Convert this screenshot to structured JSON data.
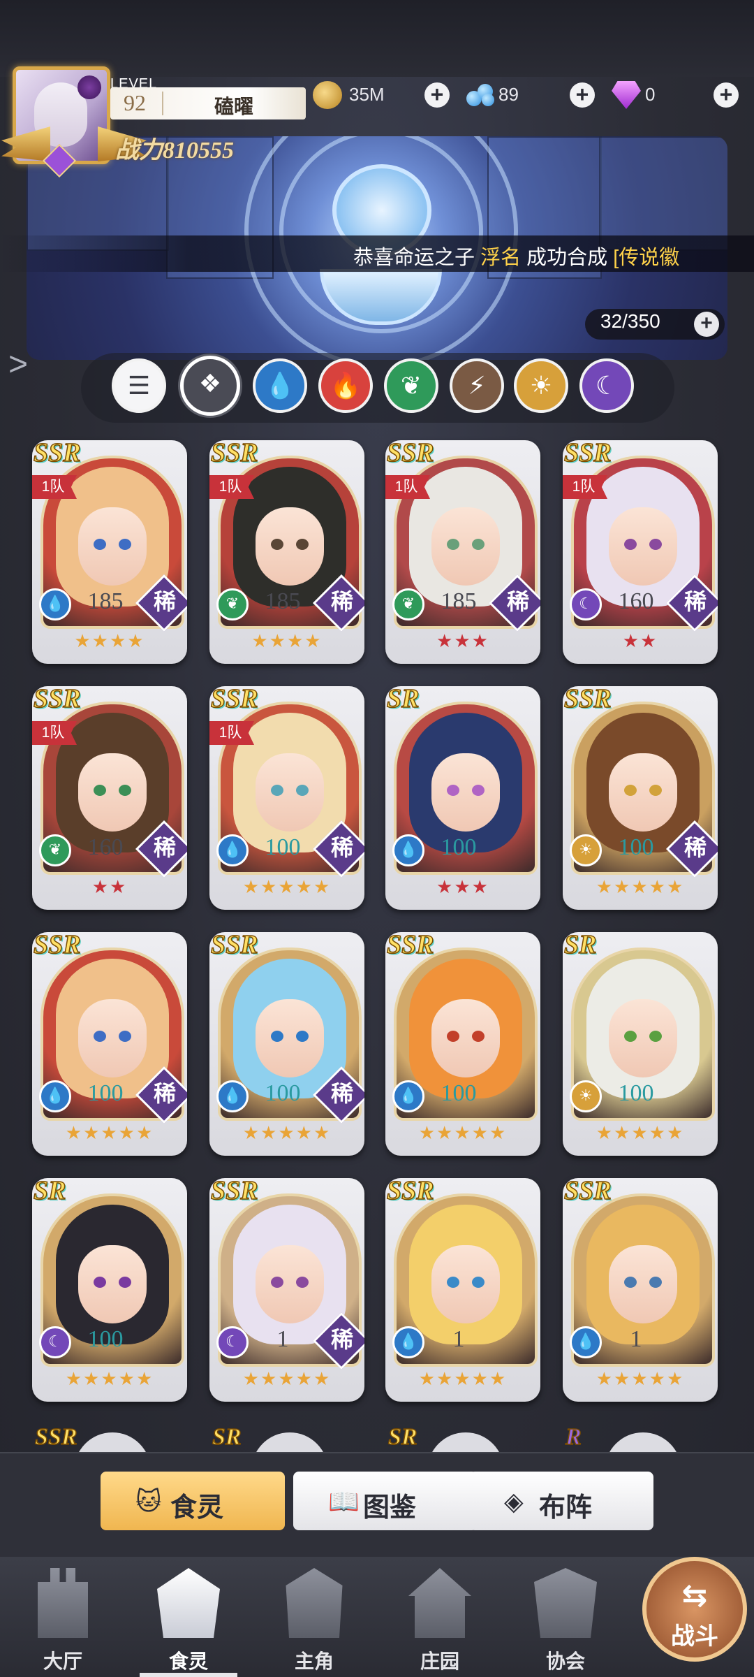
{
  "player": {
    "level_label": "LEVEL",
    "level": "92",
    "name": "磕曜",
    "power": "战力810555"
  },
  "resources": {
    "gold": {
      "icon": "gold-coin-icon",
      "value": "35M"
    },
    "bubbles": {
      "icon": "blue-bubble-icon",
      "value": "89"
    },
    "diamond": {
      "icon": "purple-diamond-icon",
      "value": "0"
    },
    "plus": "+"
  },
  "notice": {
    "prefix": "恭喜命运之子 ",
    "name": "浮名",
    "mid": " 成功合成 ",
    "item": "[传说徽"
  },
  "inventory": {
    "count": "32/350",
    "plus": "+"
  },
  "filters": [
    {
      "name": "all",
      "icon": "list-icon",
      "glyph": "☰",
      "bg": "#f5f5f7",
      "fg": "#3a3b44"
    },
    {
      "name": "generic",
      "icon": "diamond-grid-icon",
      "glyph": "❖",
      "bg": "#4a4b55",
      "fg": "#ffffff",
      "selected": true
    },
    {
      "name": "water",
      "icon": "water-drop-icon",
      "glyph": "💧",
      "bg": "#2d79c7",
      "fg": "#ffffff"
    },
    {
      "name": "fire",
      "icon": "fire-icon",
      "glyph": "🔥",
      "bg": "#d8423d",
      "fg": "#ffffff"
    },
    {
      "name": "wind",
      "icon": "leaf-icon",
      "glyph": "❦",
      "bg": "#2f9a5a",
      "fg": "#ffffff"
    },
    {
      "name": "thunder",
      "icon": "lightning-icon",
      "glyph": "⚡",
      "bg": "#7a5a44",
      "fg": "#ffffff"
    },
    {
      "name": "light",
      "icon": "sun-icon",
      "glyph": "☀",
      "bg": "#d7a03a",
      "fg": "#ffffff"
    },
    {
      "name": "dark",
      "icon": "moon-icon",
      "glyph": "☾",
      "bg": "#7348b8",
      "fg": "#ffffff"
    }
  ],
  "cards": [
    {
      "rarity": "SSR",
      "team": "1队",
      "element": "water",
      "level": "185",
      "rare": "稀",
      "stars": "★★★★",
      "bg": "#c94a3a",
      "hair": "#f0c08a",
      "eye": "#3e6dc4"
    },
    {
      "rarity": "SSR",
      "team": "1队",
      "element": "wind",
      "level": "185",
      "rare": "稀",
      "stars": "★★★★",
      "bg": "#b6423a",
      "hair": "#2e2e2a",
      "eye": "#5a4636"
    },
    {
      "rarity": "SSR",
      "team": "1队",
      "element": "wind",
      "level": "185",
      "rare": "稀",
      "stars": "★★★",
      "bg": "#b14a4a",
      "hair": "#e9e7e2",
      "eye": "#6aa07a"
    },
    {
      "rarity": "SSR",
      "team": "1队",
      "element": "dark",
      "level": "160",
      "rare": "稀",
      "stars": "★★",
      "bg": "#b9424a",
      "hair": "#e8e1f0",
      "eye": "#8a4a9e"
    },
    {
      "rarity": "SSR",
      "team": "1队",
      "element": "wind",
      "level": "160",
      "rare": "稀",
      "stars": "★★",
      "bg": "#a8463a",
      "hair": "#5a3e2a",
      "eye": "#3c8f56"
    },
    {
      "rarity": "SSR",
      "team": "1队",
      "element": "water",
      "level": "100",
      "rare": "稀",
      "stars": "★★★★★",
      "bg": "#c9563e",
      "hair": "#f2dcae",
      "eye": "#5aa6b8"
    },
    {
      "rarity": "SR",
      "team": "",
      "element": "water",
      "level": "100",
      "rare": "",
      "stars": "★★★",
      "bg": "#b84a44",
      "hair": "#2a3a6e",
      "eye": "#b064c4"
    },
    {
      "rarity": "SSR",
      "team": "",
      "element": "light",
      "level": "100",
      "rare": "稀",
      "stars": "★★★★★",
      "bg": "#caa060",
      "hair": "#7a4a2a",
      "eye": "#d2a23a"
    },
    {
      "rarity": "SSR",
      "team": "",
      "element": "water",
      "level": "100",
      "rare": "稀",
      "stars": "★★★★★",
      "bg": "#c94a3a",
      "hair": "#f0c08a",
      "eye": "#3e6dc4"
    },
    {
      "rarity": "SSR",
      "team": "",
      "element": "water",
      "level": "100",
      "rare": "稀",
      "stars": "★★★★★",
      "bg": "#d2a96a",
      "hair": "#8fd0ee",
      "eye": "#2d79c7"
    },
    {
      "rarity": "SSR",
      "team": "",
      "element": "water",
      "level": "100",
      "rare": "",
      "stars": "★★★★★",
      "bg": "#d2a96a",
      "hair": "#f0923a",
      "eye": "#c2402a"
    },
    {
      "rarity": "SR",
      "team": "",
      "element": "light",
      "level": "100",
      "rare": "",
      "stars": "★★★★★",
      "bg": "#d8c890",
      "hair": "#ecece6",
      "eye": "#5aa040"
    },
    {
      "rarity": "SR",
      "team": "",
      "element": "dark",
      "level": "100",
      "rare": "",
      "stars": "★★★★★",
      "bg": "#d2a96a",
      "hair": "#2a2830",
      "eye": "#7a3aa0"
    },
    {
      "rarity": "SSR",
      "team": "",
      "element": "dark",
      "level": "1",
      "rare": "稀",
      "stars": "★★★★★",
      "bg": "#cfb088",
      "hair": "#e8e1f0",
      "eye": "#8a4a9e"
    },
    {
      "rarity": "SSR",
      "team": "",
      "element": "water",
      "level": "1",
      "rare": "",
      "stars": "★★★★★",
      "bg": "#d2a96a",
      "hair": "#f3cf6a",
      "eye": "#3a8ac8"
    },
    {
      "rarity": "SSR",
      "team": "",
      "element": "water",
      "level": "1",
      "rare": "",
      "stars": "★★★★★",
      "bg": "#d2a96a",
      "hair": "#e9b860",
      "eye": "#4a7ab0"
    }
  ],
  "partial_row": [
    "SSR",
    "SR",
    "SR",
    "R"
  ],
  "tabs": [
    {
      "label": "食灵",
      "icon": "cat-spirit-icon",
      "glyph": "🐱",
      "active": true
    },
    {
      "label": "图鉴",
      "icon": "book-icon",
      "glyph": "📖",
      "active": false
    },
    {
      "label": "布阵",
      "icon": "formation-icon",
      "glyph": "◈",
      "active": false
    }
  ],
  "nav": [
    {
      "label": "大厅",
      "icon": "castle-icon"
    },
    {
      "label": "食灵",
      "icon": "cat-bowl-icon",
      "active": true
    },
    {
      "label": "主角",
      "icon": "helmet-icon"
    },
    {
      "label": "庄园",
      "icon": "manor-icon"
    },
    {
      "label": "协会",
      "icon": "guild-icon"
    }
  ],
  "battle": {
    "label": "战斗",
    "glyph": "⇆",
    "icon": "battle-arrows-icon"
  },
  "colors": {
    "accent_gold": "#f0b650",
    "team_red": "#c8323a",
    "level_teal": "#2a9aa0",
    "star_gold": "#e9a437"
  }
}
